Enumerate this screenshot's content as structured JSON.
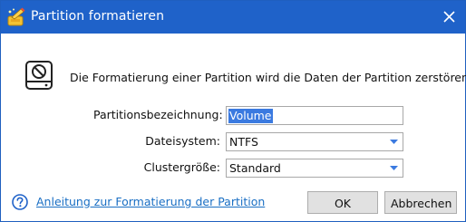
{
  "window": {
    "title": "Partition formatieren",
    "app_icon": "wizard-app-icon",
    "close_icon": "close-icon"
  },
  "warning": {
    "icon": "disk-prohibited-icon",
    "text": "Die Formatierung einer Partition wird die Daten der Partition zerstören!"
  },
  "form": {
    "partition_label": {
      "label": "Partitionsbezeichnung:",
      "value": "Volume"
    },
    "filesystem": {
      "label": "Dateisystem:",
      "value": "NTFS"
    },
    "cluster_size": {
      "label": "Clustergröße:",
      "value": "Standard"
    }
  },
  "footer": {
    "help_icon": "question-circle-icon",
    "help_link": "Anleitung zur Formatierung der Partition",
    "ok_label": "OK",
    "cancel_label": "Abbrechen"
  },
  "colors": {
    "titlebar": "#1f62c9",
    "selection": "#3b7ae0",
    "link": "#1a6fc4"
  }
}
